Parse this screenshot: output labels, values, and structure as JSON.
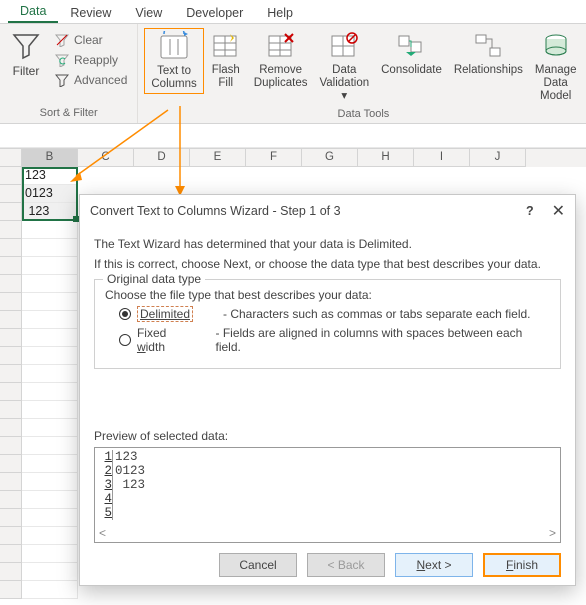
{
  "ribbon": {
    "tabs": [
      "Data",
      "Review",
      "View",
      "Developer",
      "Help"
    ],
    "active_tab": "Data",
    "groups": {
      "sort_filter": {
        "label": "Sort & Filter",
        "filter": "Filter",
        "clear": "Clear",
        "reapply": "Reapply",
        "advanced": "Advanced"
      },
      "data_tools": {
        "label": "Data Tools",
        "text_to_columns": "Text to\nColumns",
        "flash_fill": "Flash\nFill",
        "remove_duplicates": "Remove\nDuplicates",
        "data_validation": "Data\nValidation",
        "consolidate": "Consolidate",
        "relationships": "Relationships",
        "manage_data_model": "Manage\nData Model"
      }
    }
  },
  "sheet": {
    "columns": [
      "B",
      "C",
      "D",
      "E",
      "F",
      "G",
      "H",
      "I",
      "J"
    ],
    "selected_column": "B",
    "cells": {
      "B1": "123",
      "B2": "0123",
      "B3": " 123"
    }
  },
  "dialog": {
    "title": "Convert Text to Columns Wizard - Step 1 of 3",
    "intro1": "The Text Wizard has determined that your data is Delimited.",
    "intro2": "If this is correct, choose Next, or choose the data type that best describes your data.",
    "legend": "Original data type",
    "prompt": "Choose the file type that best describes your data:",
    "delimited": {
      "label": "Delimited",
      "desc": "- Characters such as commas or tabs separate each field."
    },
    "fixed": {
      "label": "Fixed width",
      "desc": "- Fields are aligned in columns with spaces between each field."
    },
    "preview_label": "Preview of selected data:",
    "preview_rows": [
      {
        "n": "1",
        "v": "123"
      },
      {
        "n": "2",
        "v": "0123"
      },
      {
        "n": "3",
        "v": " 123"
      },
      {
        "n": "4",
        "v": ""
      },
      {
        "n": "5",
        "v": ""
      }
    ],
    "buttons": {
      "cancel": "Cancel",
      "back": "< Back",
      "next": "Next >",
      "finish": "Finish"
    }
  }
}
